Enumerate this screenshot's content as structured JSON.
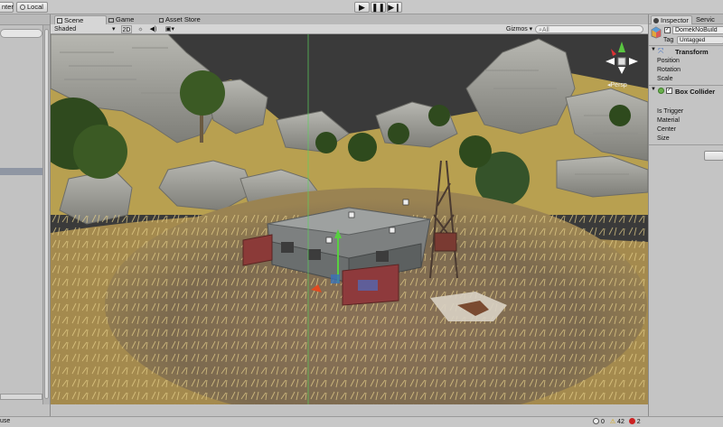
{
  "toolbar": {
    "pivot_label": "nter",
    "local_label": "Local",
    "play_icon": "play-icon",
    "pause_icon": "pause-icon",
    "step_icon": "step-icon"
  },
  "scene_tabs": {
    "scene": "Scene",
    "game": "Game",
    "asset_store": "Asset Store"
  },
  "scene_toolbar": {
    "shading": "Shaded",
    "mode_2d": "2D",
    "gizmos": "Gizmos",
    "search_placeholder": "All"
  },
  "viewport": {
    "persp_label": "Persp"
  },
  "inspector": {
    "tab": "Inspector",
    "tab2": "Servic",
    "object_name": "DomekNoBuild",
    "tag_label": "Tag",
    "tag_value": "Untagged",
    "transform": {
      "title": "Transform",
      "fields": [
        "Position",
        "Rotation",
        "Scale"
      ]
    },
    "box_collider": {
      "title": "Box Collider",
      "fields": [
        "Is Trigger",
        "Material",
        "Center",
        "Size"
      ]
    }
  },
  "statusbar": {
    "left_text": "use",
    "info_count": "0",
    "warning_count": "42",
    "error_count": "2"
  },
  "colors": {
    "sky": "#3b3b3b",
    "grass": "#c2a44a",
    "dirt": "#7e6a51",
    "panel": "#c2c2c2",
    "accent_blue": "#3a72b8"
  }
}
